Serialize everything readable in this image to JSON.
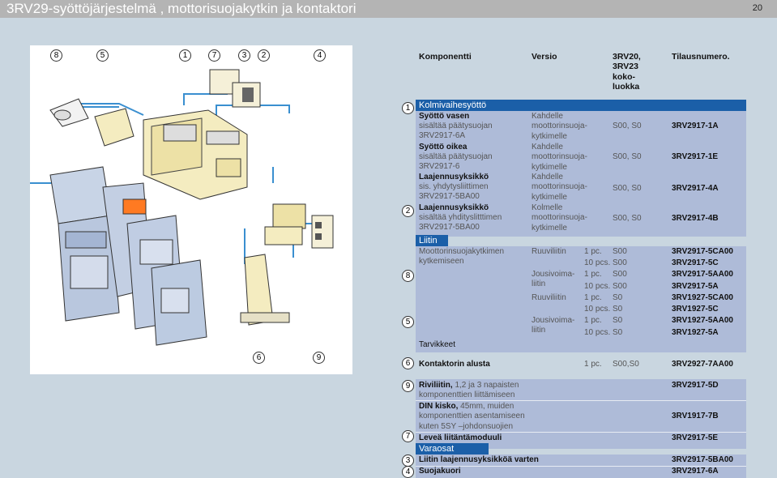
{
  "page": {
    "title": "3RV29-syöttöjärjestelmä , mottorisuojakytkin ja kontaktori",
    "number": "20"
  },
  "figure": {
    "markers_top": [
      "8",
      "5",
      "1",
      "7",
      "3",
      "2",
      "4"
    ],
    "markers_bottom": [
      "6",
      "9"
    ]
  },
  "table": {
    "headers": {
      "component": "Komponentti",
      "version": "Versio",
      "size": "3RV20,\n3RV23\nkoko-\nluokka",
      "order": "Tilausnumero."
    },
    "section1": {
      "marker": "1",
      "title": "Kolmivaihesyöttö",
      "rows": [
        {
          "name": "Syöttö vasen",
          "desc": "sisältää päätysuojan\n3RV2917-6A",
          "version": "Kahdelle\nmoottorinsuoja-\nkytkimelle",
          "size": "S00, S0",
          "order": "3RV2917-1A"
        },
        {
          "name": "Syöttö oikea",
          "desc": "sisältää päätysuojan\n3RV2917-6",
          "version": "Kahdelle\nmoottorinsuoja-\nkytkimelle",
          "size": "S00, S0",
          "order": "3RV2917-1E"
        },
        {
          "name": "Laajennusyksikkö",
          "desc": "sis. yhdytysliittimen\n3RV2917-5BA00",
          "version": "Kahdelle\nmoottorinsuoja-\nkytkimelle",
          "size": "S00, S0",
          "order": "3RV2917-4A"
        },
        {
          "name": "Laajennusyksikkö",
          "desc": "sisältää yhdityslit­ttimen\n3RV2917-5BA00",
          "version": "Kolmelle\nmoottorinsuoja-\nkytkimelle",
          "size": "S00, S0",
          "order": "3RV2917-4B",
          "marker": "2"
        }
      ]
    },
    "section2": {
      "title": "Liitin",
      "desc": "Moottorinsuojakytkimen\nkytkemiseen",
      "rows": [
        {
          "type": "Ruuviliitin",
          "qty": "1 pc.",
          "size": "S00",
          "order": "3RV2917-5CA00"
        },
        {
          "type": "",
          "qty": "10 pcs.",
          "size": "S00",
          "order": "3RV2917-5C"
        },
        {
          "type": "Jousivoima-\nliitin",
          "qty": "1 pc.",
          "size": "S00",
          "order": "3RV2917-5AA00"
        },
        {
          "type": "",
          "qty": "10 pcs.",
          "size": "S00",
          "order": "3RV2917-5A"
        },
        {
          "type": "Ruuviliitin",
          "qty": "1 pc.",
          "size": "S0",
          "order": "3RV1927-5CA00"
        },
        {
          "type": "",
          "qty": "10 pcs.",
          "size": "S0",
          "order": "3RV1927-5C"
        },
        {
          "type": "Jousivoima-\nliitin",
          "qty": "1 pc.",
          "size": "S0",
          "order": "3RV1927-5AA00"
        },
        {
          "type": "",
          "qty": "10 pcs.",
          "size": "S0",
          "order": "3RV1927-5A"
        }
      ],
      "markers": [
        "8",
        "5"
      ]
    },
    "accessories": {
      "title": "Tarvikkeet",
      "contactor": {
        "marker": "6",
        "name": "Kontaktorin alusta",
        "qty": "1 pc.",
        "size": "S00,S0",
        "order": "3RV2927-7AA00"
      },
      "items": [
        {
          "marker": "9",
          "name": "Riviliitin,",
          "rest": " 1,2 ja 3 napaisten\nkomponenttien liittämiseen",
          "order": "3RV2917-5D"
        },
        {
          "marker": "",
          "name": "DIN kisko,",
          "rest": " 45mm, muiden\nkomponenttien asentamiseen\nkuten 5SY –johdonsuojien",
          "order": "3RV1917-7B"
        },
        {
          "marker": "7",
          "name": "Leveä liitäntämoduuli",
          "rest": "",
          "order": "3RV2917-5E"
        }
      ]
    },
    "spares": {
      "title": "Varaosat",
      "items": [
        {
          "marker": "3",
          "name": "Liitin laajennusyksikköä varten",
          "order": "3RV2917-5BA00"
        },
        {
          "marker": "4",
          "name": "Suojakuori",
          "order": "3RV2917-6A"
        }
      ]
    }
  },
  "colors": {
    "band": "#1b5fa8",
    "row": "#aebbd8",
    "background": "#c9d6e0",
    "header": "#b4b4b4"
  }
}
